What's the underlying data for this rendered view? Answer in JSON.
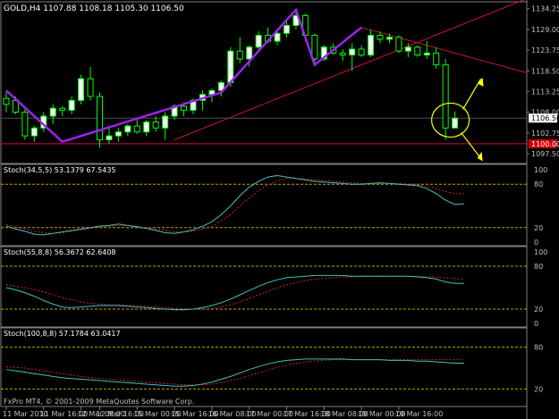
{
  "window": {
    "symbol_header": "GOLD,H4  1107.88 1108.18 1105.30 1106.50",
    "copyright": "FxPro MT4, © 2001-2009 MetaQuotes Software Corp."
  },
  "colors": {
    "background": "#000000",
    "bull_candle": "#ffffff",
    "bear_candle": "#000000",
    "wick": "#00ff00",
    "zigzag": "#a020f0",
    "trendline": "#cc1144",
    "annotation": "#ffff00",
    "stoch_main": "#40c0c0",
    "stoch_signal": "#cc2233",
    "level": "#c8a000",
    "axis_text": "#c0c0c0",
    "current_price_bg": "#ffffff",
    "horizontal_line_label_bg": "#cc0000"
  },
  "chart_data": {
    "type": "candlestick",
    "price_scale": {
      "min": 1095.0,
      "max": 1136.0,
      "ticks": [
        "1134.25",
        "1129.00",
        "1123.75",
        "1118.50",
        "1113.25",
        "1108.00",
        "1102.75",
        "1097.50"
      ],
      "tick_values": [
        1134.25,
        1129.0,
        1123.75,
        1118.5,
        1113.25,
        1108.0,
        1102.75,
        1097.5
      ],
      "current_price": "1106.50",
      "current_price_value": 1106.5,
      "hline_label": "1100.00",
      "hline_value": 1100.0
    },
    "time_axis": {
      "labels": [
        "11 Mar 2010",
        "11 Mar 16:00",
        "12 Mar 08:00",
        "12 Mar 16:00",
        "15 Mar 00:00",
        "15 Mar 16:00",
        "16 Mar 08:00",
        "17 Mar 00:00",
        "17 Mar 16:00",
        "18 Mar 08:00",
        "19 Mar 00:00",
        "19 Mar 16:00"
      ],
      "label_bar_index": [
        0,
        4,
        8,
        10,
        14,
        18,
        22,
        26,
        30,
        34,
        38,
        42
      ]
    },
    "candles": [
      {
        "o": 1111.5,
        "h": 1113.0,
        "l": 1108.0,
        "c": 1110.0
      },
      {
        "o": 1111.0,
        "h": 1112.0,
        "l": 1107.5,
        "c": 1108.0
      },
      {
        "o": 1108.0,
        "h": 1109.0,
        "l": 1101.0,
        "c": 1102.0
      },
      {
        "o": 1102.0,
        "h": 1104.5,
        "l": 1100.5,
        "c": 1104.0
      },
      {
        "o": 1104.0,
        "h": 1108.0,
        "l": 1103.0,
        "c": 1107.0
      },
      {
        "o": 1107.0,
        "h": 1110.0,
        "l": 1105.0,
        "c": 1109.0
      },
      {
        "o": 1109.0,
        "h": 1109.5,
        "l": 1107.0,
        "c": 1108.5
      },
      {
        "o": 1108.5,
        "h": 1112.0,
        "l": 1107.5,
        "c": 1111.0
      },
      {
        "o": 1111.0,
        "h": 1117.5,
        "l": 1110.0,
        "c": 1116.5
      },
      {
        "o": 1116.5,
        "h": 1119.5,
        "l": 1111.0,
        "c": 1112.0
      },
      {
        "o": 1112.0,
        "h": 1113.0,
        "l": 1099.0,
        "c": 1101.0
      },
      {
        "o": 1101.0,
        "h": 1104.0,
        "l": 1100.0,
        "c": 1102.0
      },
      {
        "o": 1102.0,
        "h": 1104.0,
        "l": 1100.5,
        "c": 1103.0
      },
      {
        "o": 1103.0,
        "h": 1105.0,
        "l": 1102.0,
        "c": 1104.5
      },
      {
        "o": 1104.5,
        "h": 1106.0,
        "l": 1102.5,
        "c": 1103.0
      },
      {
        "o": 1103.0,
        "h": 1106.0,
        "l": 1102.0,
        "c": 1105.5
      },
      {
        "o": 1105.5,
        "h": 1107.0,
        "l": 1103.0,
        "c": 1104.0
      },
      {
        "o": 1104.0,
        "h": 1108.0,
        "l": 1101.0,
        "c": 1107.0
      },
      {
        "o": 1107.0,
        "h": 1110.0,
        "l": 1106.0,
        "c": 1109.5
      },
      {
        "o": 1109.5,
        "h": 1110.5,
        "l": 1107.0,
        "c": 1108.5
      },
      {
        "o": 1108.5,
        "h": 1111.5,
        "l": 1107.5,
        "c": 1111.0
      },
      {
        "o": 1111.0,
        "h": 1113.5,
        "l": 1108.5,
        "c": 1112.5
      },
      {
        "o": 1112.5,
        "h": 1114.0,
        "l": 1110.5,
        "c": 1113.5
      },
      {
        "o": 1113.5,
        "h": 1116.0,
        "l": 1112.0,
        "c": 1115.5
      },
      {
        "o": 1115.5,
        "h": 1124.5,
        "l": 1114.5,
        "c": 1123.5
      },
      {
        "o": 1123.5,
        "h": 1127.0,
        "l": 1120.5,
        "c": 1121.5
      },
      {
        "o": 1121.5,
        "h": 1125.0,
        "l": 1119.5,
        "c": 1124.5
      },
      {
        "o": 1124.5,
        "h": 1128.5,
        "l": 1123.5,
        "c": 1127.5
      },
      {
        "o": 1127.5,
        "h": 1129.5,
        "l": 1125.5,
        "c": 1126.0
      },
      {
        "o": 1126.0,
        "h": 1129.0,
        "l": 1125.0,
        "c": 1128.0
      },
      {
        "o": 1128.0,
        "h": 1131.0,
        "l": 1127.0,
        "c": 1130.0
      },
      {
        "o": 1130.0,
        "h": 1133.5,
        "l": 1129.0,
        "c": 1132.5
      },
      {
        "o": 1132.5,
        "h": 1133.0,
        "l": 1126.0,
        "c": 1127.5
      },
      {
        "o": 1127.5,
        "h": 1128.0,
        "l": 1120.0,
        "c": 1121.5
      },
      {
        "o": 1121.5,
        "h": 1125.0,
        "l": 1121.0,
        "c": 1124.5
      },
      {
        "o": 1124.5,
        "h": 1125.5,
        "l": 1122.5,
        "c": 1123.0
      },
      {
        "o": 1123.0,
        "h": 1124.0,
        "l": 1121.0,
        "c": 1122.5
      },
      {
        "o": 1122.5,
        "h": 1125.5,
        "l": 1118.5,
        "c": 1124.0
      },
      {
        "o": 1124.0,
        "h": 1125.0,
        "l": 1122.0,
        "c": 1122.5
      },
      {
        "o": 1122.5,
        "h": 1129.0,
        "l": 1122.0,
        "c": 1127.5
      },
      {
        "o": 1127.5,
        "h": 1128.5,
        "l": 1125.5,
        "c": 1126.5
      },
      {
        "o": 1126.5,
        "h": 1128.0,
        "l": 1125.5,
        "c": 1127.0
      },
      {
        "o": 1127.0,
        "h": 1127.5,
        "l": 1123.0,
        "c": 1123.5
      },
      {
        "o": 1123.5,
        "h": 1125.5,
        "l": 1122.0,
        "c": 1124.5
      },
      {
        "o": 1124.5,
        "h": 1125.0,
        "l": 1122.0,
        "c": 1122.5
      },
      {
        "o": 1122.5,
        "h": 1126.0,
        "l": 1121.5,
        "c": 1123.0
      },
      {
        "o": 1123.0,
        "h": 1124.5,
        "l": 1119.0,
        "c": 1120.0
      },
      {
        "o": 1120.0,
        "h": 1121.5,
        "l": 1101.0,
        "c": 1104.0
      },
      {
        "o": 1104.0,
        "h": 1108.2,
        "l": 1105.3,
        "c": 1106.5
      }
    ],
    "zigzag": {
      "bar_index": [
        0,
        6,
        23,
        31,
        33,
        38
      ],
      "price": [
        1113.5,
        1100.5,
        1113.0,
        1134.0,
        1120.0,
        1129.5
      ]
    },
    "trendlines": [
      {
        "from": [
          18,
          1101.0
        ],
        "to": [
          48,
          1129.5
        ]
      },
      {
        "from": [
          38,
          1129.5
        ],
        "to": [
          48,
          1123.0
        ]
      }
    ],
    "horizontal_lines": [
      1100.0
    ],
    "stochastics": [
      {
        "label": "Stoch(34,5,5) 53.1379 67.5435",
        "levels": [
          80,
          20
        ],
        "scale_ticks": [
          "100",
          "80",
          "20",
          "0"
        ],
        "main": [
          22,
          18,
          15,
          11,
          10,
          12,
          14,
          16,
          18,
          20,
          22,
          23,
          25,
          23,
          21,
          19,
          16,
          13,
          12,
          14,
          17,
          22,
          28,
          38,
          50,
          64,
          76,
          84,
          90,
          92,
          90,
          88,
          86,
          84,
          83,
          82,
          81,
          80,
          80,
          81,
          82,
          81,
          80,
          79,
          78,
          74,
          67,
          58,
          52,
          53
        ],
        "signal": [
          24,
          21,
          18,
          15,
          13,
          12,
          13,
          15,
          17,
          19,
          21,
          22,
          23,
          23,
          22,
          20,
          18,
          16,
          14,
          14,
          15,
          18,
          22,
          29,
          38,
          50,
          61,
          71,
          79,
          85,
          88,
          88,
          87,
          86,
          85,
          84,
          83,
          82,
          81,
          81,
          81,
          81,
          81,
          80,
          79,
          77,
          74,
          70,
          67,
          67
        ]
      },
      {
        "label": "Stoch(55,8,8) 56.3672 62.6408",
        "levels": [
          80,
          20
        ],
        "scale_ticks": [
          "100",
          "80",
          "20",
          "0"
        ],
        "main": [
          50,
          47,
          43,
          38,
          32,
          27,
          23,
          22,
          23,
          24,
          25,
          25,
          25,
          24,
          23,
          22,
          21,
          20,
          19,
          19,
          20,
          22,
          25,
          29,
          34,
          40,
          46,
          52,
          57,
          61,
          64,
          65,
          66,
          67,
          67,
          67,
          67,
          66,
          66,
          66,
          66,
          66,
          66,
          66,
          65,
          64,
          62,
          58,
          56,
          56
        ],
        "signal": [
          54,
          52,
          50,
          47,
          44,
          40,
          36,
          33,
          30,
          28,
          27,
          26,
          26,
          25,
          25,
          24,
          23,
          22,
          21,
          20,
          20,
          20,
          21,
          23,
          26,
          30,
          35,
          40,
          45,
          50,
          54,
          57,
          60,
          62,
          63,
          64,
          65,
          65,
          66,
          66,
          66,
          66,
          66,
          66,
          66,
          65,
          65,
          64,
          63,
          62
        ]
      },
      {
        "label": "Stoch(100,8,8) 57.1784 63.0417",
        "levels": [
          80,
          20
        ],
        "scale_ticks": [
          "80",
          "20"
        ],
        "main": [
          48,
          46,
          44,
          42,
          40,
          38,
          36,
          35,
          34,
          33,
          32,
          31,
          30,
          29,
          28,
          27,
          26,
          25,
          24,
          24,
          25,
          27,
          30,
          34,
          38,
          43,
          48,
          52,
          56,
          59,
          61,
          62,
          63,
          63,
          63,
          63,
          63,
          62,
          62,
          62,
          62,
          61,
          61,
          61,
          60,
          60,
          59,
          58,
          57,
          57
        ],
        "signal": [
          52,
          51,
          50,
          48,
          46,
          44,
          42,
          40,
          38,
          36,
          35,
          34,
          33,
          32,
          31,
          30,
          29,
          28,
          27,
          26,
          26,
          26,
          27,
          29,
          32,
          35,
          39,
          43,
          47,
          51,
          54,
          57,
          59,
          60,
          61,
          62,
          62,
          62,
          62,
          62,
          62,
          62,
          62,
          62,
          62,
          62,
          62,
          62,
          62,
          63
        ]
      }
    ]
  }
}
